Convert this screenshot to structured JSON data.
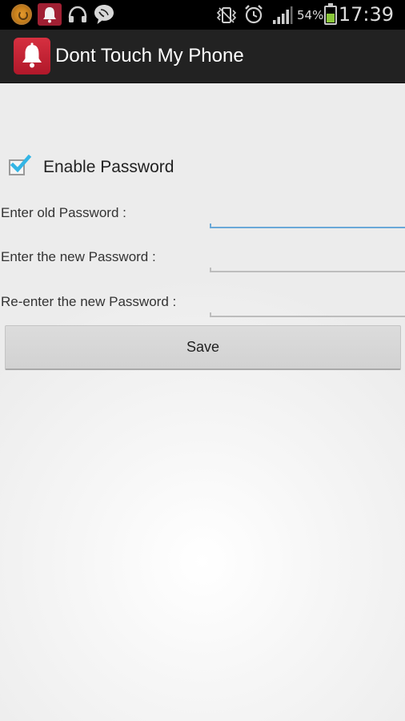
{
  "status_bar": {
    "notifications": [
      "firefox-icon",
      "app-bell-icon",
      "headset-icon",
      "chat-icon"
    ],
    "indicators": [
      "vibrate-icon",
      "alarm-icon",
      "signal-icon"
    ],
    "battery_percent": "54%",
    "battery_level": 0.54,
    "time": "17:39"
  },
  "action_bar": {
    "icon": "bell-icon",
    "title": "Dont Touch My Phone",
    "background": "#222222"
  },
  "form": {
    "enable_password": {
      "label": "Enable Password",
      "checked": true
    },
    "fields": [
      {
        "label": "Enter old Password :",
        "value": "",
        "focused": true
      },
      {
        "label": "Enter the new Password :",
        "value": "",
        "focused": false
      },
      {
        "label": "Re-enter the new Password :",
        "value": "",
        "focused": false
      }
    ],
    "save_label": "Save"
  },
  "colors": {
    "accent": "#33b5e5",
    "focus_underline": "#6aa8d8",
    "app_icon": "#c8202f"
  }
}
